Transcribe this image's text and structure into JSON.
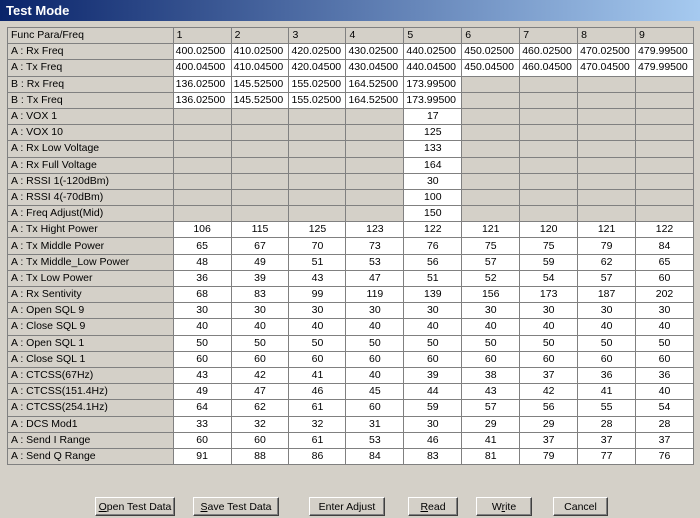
{
  "window": {
    "title": "Test Mode"
  },
  "grid": {
    "corner": "Func Para/Freq",
    "columns": [
      "1",
      "2",
      "3",
      "4",
      "5",
      "6",
      "7",
      "8",
      "9"
    ],
    "rows": [
      {
        "label": "A : Rx Freq",
        "freq": true,
        "cells": [
          "400.02500",
          "410.02500",
          "420.02500",
          "430.02500",
          "440.02500",
          "450.02500",
          "460.02500",
          "470.02500",
          "479.99500"
        ]
      },
      {
        "label": "A : Tx Freq",
        "freq": true,
        "cells": [
          "400.04500",
          "410.04500",
          "420.04500",
          "430.04500",
          "440.04500",
          "450.04500",
          "460.04500",
          "470.04500",
          "479.99500"
        ]
      },
      {
        "label": "B : Rx Freq",
        "freq": true,
        "cells": [
          "136.02500",
          "145.52500",
          "155.02500",
          "164.52500",
          "173.99500",
          "",
          "",
          "",
          ""
        ]
      },
      {
        "label": "B : Tx Freq",
        "freq": true,
        "cells": [
          "136.02500",
          "145.52500",
          "155.02500",
          "164.52500",
          "173.99500",
          "",
          "",
          "",
          ""
        ]
      },
      {
        "label": "A : VOX 1",
        "cells": [
          "",
          "",
          "",
          "",
          "17",
          "",
          "",
          "",
          ""
        ]
      },
      {
        "label": "A : VOX 10",
        "cells": [
          "",
          "",
          "",
          "",
          "125",
          "",
          "",
          "",
          ""
        ]
      },
      {
        "label": "A : Rx Low Voltage",
        "cells": [
          "",
          "",
          "",
          "",
          "133",
          "",
          "",
          "",
          ""
        ]
      },
      {
        "label": "A : Rx Full Voltage",
        "cells": [
          "",
          "",
          "",
          "",
          "164",
          "",
          "",
          "",
          ""
        ]
      },
      {
        "label": "A : RSSI 1(-120dBm)",
        "cells": [
          "",
          "",
          "",
          "",
          "30",
          "",
          "",
          "",
          ""
        ]
      },
      {
        "label": "A : RSSI 4(-70dBm)",
        "cells": [
          "",
          "",
          "",
          "",
          "100",
          "",
          "",
          "",
          ""
        ]
      },
      {
        "label": "A : Freq Adjust(Mid)",
        "cells": [
          "",
          "",
          "",
          "",
          "150",
          "",
          "",
          "",
          ""
        ]
      },
      {
        "label": "A : Tx Hight Power",
        "cells": [
          "106",
          "115",
          "125",
          "123",
          "122",
          "121",
          "120",
          "121",
          "122"
        ]
      },
      {
        "label": "A : Tx Middle Power",
        "cells": [
          "65",
          "67",
          "70",
          "73",
          "76",
          "75",
          "75",
          "79",
          "84"
        ]
      },
      {
        "label": "A : Tx Middle_Low Power",
        "cells": [
          "48",
          "49",
          "51",
          "53",
          "56",
          "57",
          "59",
          "62",
          "65"
        ]
      },
      {
        "label": "A : Tx Low Power",
        "cells": [
          "36",
          "39",
          "43",
          "47",
          "51",
          "52",
          "54",
          "57",
          "60"
        ]
      },
      {
        "label": "A : Rx Sentivity",
        "cells": [
          "68",
          "83",
          "99",
          "119",
          "139",
          "156",
          "173",
          "187",
          "202"
        ]
      },
      {
        "label": "A : Open SQL 9",
        "cells": [
          "30",
          "30",
          "30",
          "30",
          "30",
          "30",
          "30",
          "30",
          "30"
        ]
      },
      {
        "label": "A : Close SQL 9",
        "cells": [
          "40",
          "40",
          "40",
          "40",
          "40",
          "40",
          "40",
          "40",
          "40"
        ]
      },
      {
        "label": "A : Open SQL 1",
        "cells": [
          "50",
          "50",
          "50",
          "50",
          "50",
          "50",
          "50",
          "50",
          "50"
        ]
      },
      {
        "label": "A : Close SQL 1",
        "cells": [
          "60",
          "60",
          "60",
          "60",
          "60",
          "60",
          "60",
          "60",
          "60"
        ]
      },
      {
        "label": "A : CTCSS(67Hz)",
        "cells": [
          "43",
          "42",
          "41",
          "40",
          "39",
          "38",
          "37",
          "36",
          "36"
        ]
      },
      {
        "label": "A : CTCSS(151.4Hz)",
        "cells": [
          "49",
          "47",
          "46",
          "45",
          "44",
          "43",
          "42",
          "41",
          "40"
        ]
      },
      {
        "label": "A : CTCSS(254.1Hz)",
        "cells": [
          "64",
          "62",
          "61",
          "60",
          "59",
          "57",
          "56",
          "55",
          "54"
        ]
      },
      {
        "label": "A : DCS Mod1",
        "cells": [
          "33",
          "32",
          "32",
          "31",
          "30",
          "29",
          "29",
          "28",
          "28"
        ]
      },
      {
        "label": "A : Send I Range",
        "cells": [
          "60",
          "60",
          "61",
          "53",
          "46",
          "41",
          "37",
          "37",
          "37"
        ]
      },
      {
        "label": "A : Send Q Range",
        "cells": [
          "91",
          "88",
          "86",
          "84",
          "83",
          "81",
          "79",
          "77",
          "76"
        ]
      }
    ]
  },
  "buttons": [
    {
      "name": "open-test-data-button",
      "acc": "O",
      "rest": "pen Test Data"
    },
    {
      "name": "save-test-data-button",
      "acc": "S",
      "rest": "ave Test Data"
    },
    {
      "name": "enter-adjust-button",
      "pre": "Enter Ad",
      "acc": "j",
      "rest": "ust"
    },
    {
      "name": "read-button",
      "acc": "R",
      "rest": "ead"
    },
    {
      "name": "write-button",
      "pre": "W",
      "acc": "r",
      "rest": "ite"
    },
    {
      "name": "cancel-button",
      "acc": "",
      "rest": "Cancel"
    }
  ]
}
